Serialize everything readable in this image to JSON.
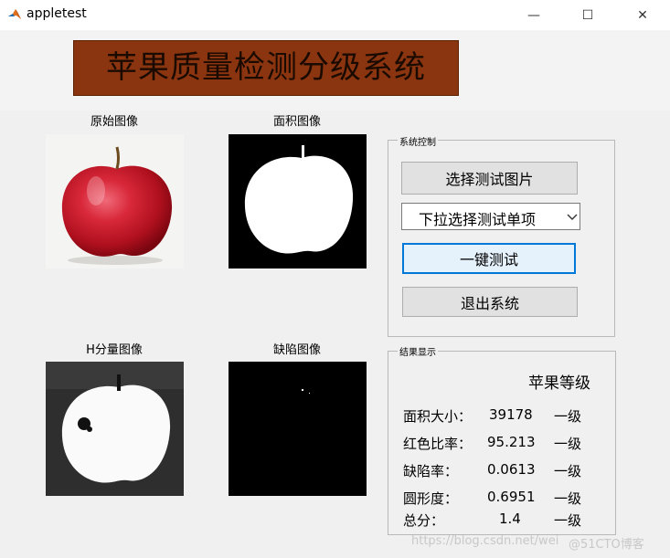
{
  "window": {
    "title": "appletest",
    "min_glyph": "—",
    "max_glyph": "☐",
    "close_glyph": "✕"
  },
  "banner": {
    "title": "苹果质量检测分级系统"
  },
  "images": {
    "original": "原始图像",
    "area": "面积图像",
    "h_component": "H分量图像",
    "defect": "缺陷图像"
  },
  "control_panel": {
    "title": "系统控制",
    "select_image_button": "选择测试图片",
    "dropdown_value": "下拉选择测试单项",
    "one_click_test_button": "一键测试",
    "exit_button": "退出系统"
  },
  "result_panel": {
    "title": "结果显示",
    "grade_header": "苹果等级",
    "rows": [
      {
        "label": "面积大小：",
        "value": "39178",
        "grade": "一级"
      },
      {
        "label": "红色比率：",
        "value": "95.213",
        "grade": "一级"
      },
      {
        "label": "缺陷率：",
        "value": "0.0613",
        "grade": "一级"
      },
      {
        "label": "圆形度：",
        "value": "0.6951",
        "grade": "一级"
      },
      {
        "label": "总分：",
        "value": "1.4",
        "grade": "一级"
      }
    ]
  },
  "watermark": {
    "left": "https://blog.csdn.net/wei",
    "right": "@51CTO博客"
  },
  "colors": {
    "banner_bg": "#8b3510",
    "focus_border": "#0078d7"
  }
}
